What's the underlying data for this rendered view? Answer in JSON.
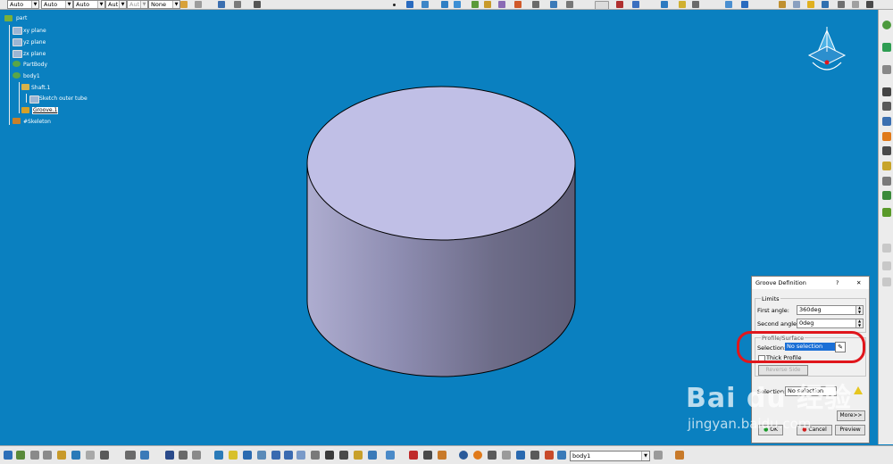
{
  "toolbar_top": {
    "dropdowns": [
      {
        "value": "Auto"
      },
      {
        "value": "Auto"
      },
      {
        "value": "Auto"
      },
      {
        "value": "Aut"
      },
      {
        "value": "Aut"
      },
      {
        "value": "None"
      }
    ]
  },
  "tree": {
    "root": "part",
    "items": [
      {
        "label": "xy plane"
      },
      {
        "label": "yz plane"
      },
      {
        "label": "zx plane"
      },
      {
        "label": "PartBody"
      },
      {
        "label": "body1"
      },
      {
        "label": "Shaft.1"
      },
      {
        "label": "Sketch outer tube"
      },
      {
        "label": "Groove.1"
      },
      {
        "label": "#Skeleton"
      }
    ]
  },
  "dialog": {
    "title": "Groove Definition",
    "help_glyph": "?",
    "close_glyph": "✕",
    "limits_label": "Limits",
    "first_angle_label": "First angle:",
    "first_angle_value": "360deg",
    "second_angle_label": "Second angle:",
    "second_angle_value": "0deg",
    "profile_surface_label": "Profile/Surface",
    "profile_selection_label": "Selection:",
    "profile_selection_value": "No selection",
    "thick_profile_label": "Thick Profile",
    "reverse_side_label": "Reverse Side",
    "axis_selection_label": "Selection:",
    "axis_selection_value": "No selection",
    "more_label": "More>>",
    "ok_label": "OK",
    "cancel_label": "Cancel",
    "preview_label": "Preview"
  },
  "status": {
    "current_body": "body1"
  },
  "watermark": {
    "logo": "Bai du 经验",
    "url": "jingyan.baidu.com"
  },
  "colors": {
    "background": "#0a80c0",
    "cylinder_top": "#c0bfe6",
    "highlight_red": "#e0161c"
  }
}
